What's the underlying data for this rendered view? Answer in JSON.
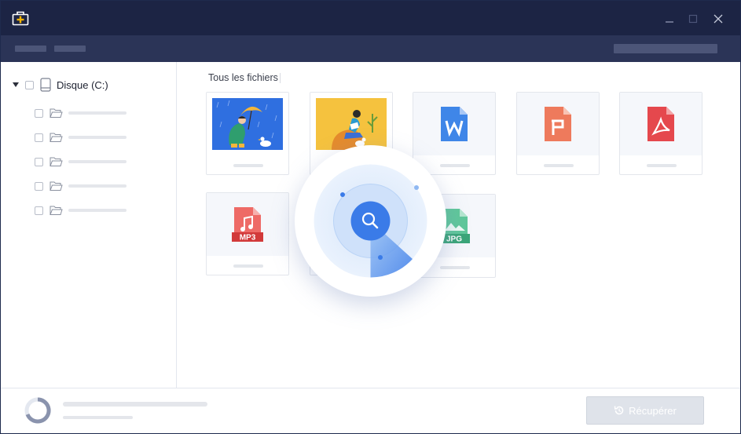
{
  "colors": {
    "titlebar": "#1c2444",
    "toolbar": "#2b3457",
    "accent": "#3a7be8",
    "app_icon": "#f5b400",
    "button_disabled": "#dfe3ea"
  },
  "sidebar": {
    "root": {
      "label": "Disque (C:)",
      "icon": "disk-icon"
    },
    "folders": [
      {
        "icon": "folder-icon"
      },
      {
        "icon": "folder-icon"
      },
      {
        "icon": "folder-icon"
      },
      {
        "icon": "folder-icon"
      },
      {
        "icon": "folder-icon"
      }
    ]
  },
  "main": {
    "breadcrumb": "Tous les fichiers",
    "file_types": [
      {
        "icon": "photo-umbrella-thumbnail"
      },
      {
        "icon": "photo-reading-thumbnail"
      },
      {
        "icon": "word-document-icon"
      },
      {
        "icon": "powerpoint-document-icon"
      },
      {
        "icon": "pdf-document-icon"
      },
      {
        "icon": "mp3-audio-icon",
        "badge": "MP3"
      },
      {
        "icon": "jpg-image-icon",
        "badge": "JPG"
      }
    ]
  },
  "scan": {
    "icon": "search-icon"
  },
  "footer": {
    "recover_label": "Récupérer",
    "recover_icon": "restore-icon"
  }
}
